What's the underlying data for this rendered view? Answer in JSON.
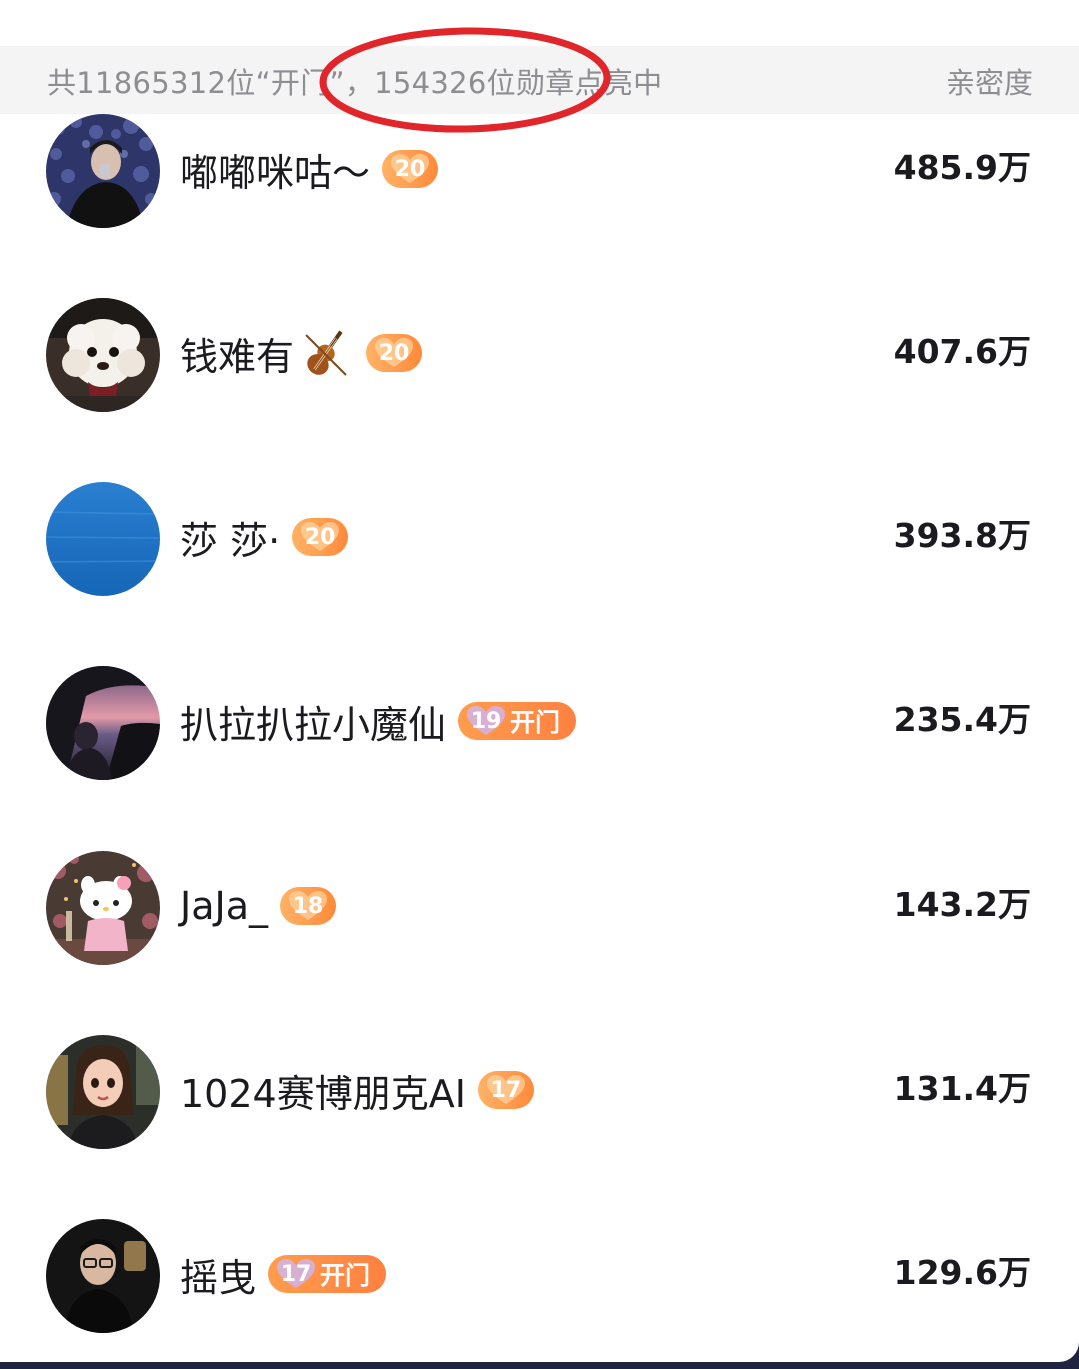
{
  "header": {
    "summary": "共11865312位“开门”，154326位勋章点亮中",
    "column_label": "亲密度"
  },
  "colors": {
    "badge_orange": "#ff8a3a",
    "annotation_red": "#e0262b"
  },
  "fans": [
    {
      "name": "嘟嘟咪咕～",
      "emoji": "",
      "level": "20",
      "tag": "",
      "score": "485.9万",
      "avatar": "night-portrait"
    },
    {
      "name": "钱难有",
      "emoji": "violin-icon",
      "level": "20",
      "tag": "",
      "score": "407.6万",
      "avatar": "white-dog"
    },
    {
      "name": "莎 莎·",
      "emoji": "",
      "level": "20",
      "tag": "",
      "score": "393.8万",
      "avatar": "blue-sea"
    },
    {
      "name": "扒拉扒拉小魔仙",
      "emoji": "",
      "level": "19",
      "tag": "开门",
      "score": "235.4万",
      "avatar": "car-sunset"
    },
    {
      "name": "JaJa_",
      "emoji": "",
      "level": "18",
      "tag": "",
      "score": "143.2万",
      "avatar": "hello-kitty"
    },
    {
      "name": "1024赛博朋克AI",
      "emoji": "",
      "level": "17",
      "tag": "",
      "score": "131.4万",
      "avatar": "cartoon-girl"
    },
    {
      "name": "摇曳",
      "emoji": "",
      "level": "17",
      "tag": "开门",
      "score": "129.6万",
      "avatar": "man-glasses"
    }
  ]
}
